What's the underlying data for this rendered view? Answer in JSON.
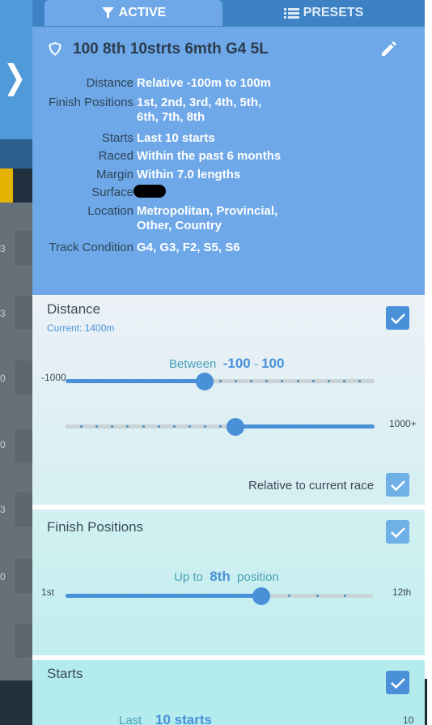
{
  "background": {
    "row_digits": [
      "3",
      "3",
      "0",
      "0",
      "3",
      "0"
    ]
  },
  "tabs": {
    "active_label": "ACTIVE",
    "presets_label": "PRESETS"
  },
  "summary": {
    "title": "100 8th 10strts 6mth G4 5L",
    "rows": [
      {
        "label": "Distance",
        "value": "Relative -100m to 100m"
      },
      {
        "label": "Finish Positions",
        "value": "1st, 2nd, 3rd, 4th, 5th, 6th, 7th, 8th"
      },
      {
        "label": "Starts",
        "value": "Last 10 starts"
      },
      {
        "label": "Raced",
        "value": "Within the past 6 months"
      },
      {
        "label": "Margin",
        "value": "Within 7.0 lengths"
      },
      {
        "label": "Surface",
        "value": ""
      },
      {
        "label": "Location",
        "value": "Metropolitan, Provincial, Other, Country"
      },
      {
        "label": "Track Condition",
        "value": "G4, G3, F2, S5, S6"
      }
    ]
  },
  "distance": {
    "title": "Distance",
    "current": "Current: 1400m",
    "checked": true,
    "between_label": "Between",
    "low": "-100",
    "sep": "-",
    "high": "100",
    "min_label": "-1000",
    "max_label": "1000+",
    "low_fraction": 0.45,
    "high_fraction": 0.55,
    "relative_label": "Relative to current race",
    "relative_checked": true
  },
  "finish": {
    "title": "Finish Positions",
    "checked": true,
    "prefix": "Up to",
    "value": "8th",
    "suffix": "position",
    "min_label": "1st",
    "max_label": "12th",
    "fraction": 0.636
  },
  "starts": {
    "title": "Starts",
    "checked": true,
    "prefix": "Last",
    "value": "10 starts",
    "max_label": "10"
  },
  "colors": {
    "accent": "#4a90d9",
    "summary_bg": "#6ea8e8",
    "tabbar_bg": "#3e82c6"
  }
}
